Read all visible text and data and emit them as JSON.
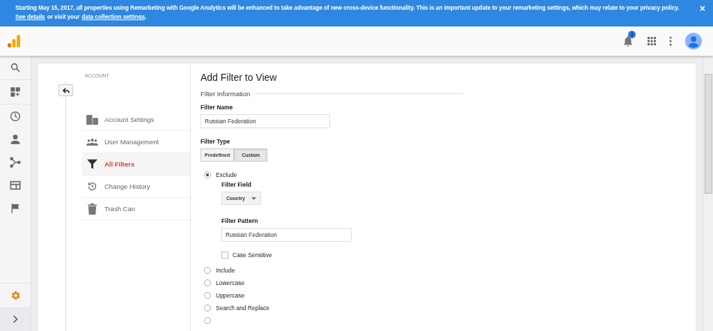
{
  "banner": {
    "text": "Starting May 15, 2017, all properties using Remarketing with Google Analytics will be enhanced to take advantage of new cross-device functionality. This is an important update to your remarketing settings, which may relate to your privacy policy.",
    "link1": "See details",
    "middle": "or visit your",
    "link2": "data collection settings",
    "end": ".",
    "close": "×"
  },
  "header": {
    "notifications": "3"
  },
  "nav": [
    {
      "kind": "search"
    },
    {
      "kind": "dashboard"
    },
    {
      "kind": "clock"
    },
    {
      "kind": "person"
    },
    {
      "kind": "share"
    },
    {
      "kind": "screen"
    },
    {
      "kind": "flag"
    }
  ],
  "account": {
    "heading": "ACCOUNT",
    "items": [
      {
        "label": "Account Settings",
        "kind": "building",
        "selected": false
      },
      {
        "label": "User Management",
        "kind": "people",
        "selected": false
      },
      {
        "label": "All Filters",
        "kind": "filter",
        "selected": true
      },
      {
        "label": "Change History",
        "kind": "history",
        "selected": false
      },
      {
        "label": "Trash Can",
        "kind": "trash",
        "selected": false
      }
    ]
  },
  "form": {
    "title": "Add Filter to View",
    "section": "Filter Information",
    "name_label": "Filter Name",
    "name_value": "Russian Federation",
    "type_label": "Filter Type",
    "type_tabs": [
      {
        "label": "Predefined",
        "selected": false
      },
      {
        "label": "Custom",
        "selected": true
      }
    ],
    "options": [
      {
        "label": "Exclude",
        "selected": true,
        "field_label": "Filter Field",
        "field_value": "Country",
        "pattern_label": "Filter Pattern",
        "pattern_value": "Russian Federation",
        "case_label": "Case Sensitive",
        "case_checked": false
      },
      {
        "label": "Include",
        "selected": false
      },
      {
        "label": "Lowercase",
        "selected": false
      },
      {
        "label": "Uppercase",
        "selected": false
      },
      {
        "label": "Search and Replace",
        "selected": false
      },
      {
        "selected": false
      }
    ]
  }
}
